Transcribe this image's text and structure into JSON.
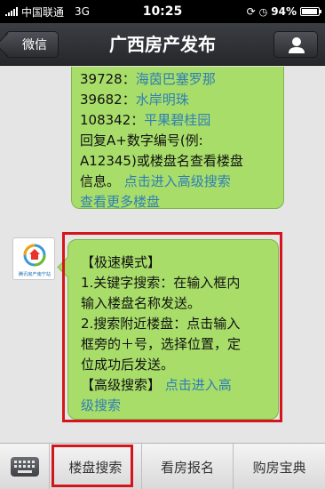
{
  "status_bar": {
    "carrier": "中国联通",
    "network": "3G",
    "time": "10:25",
    "battery": "94%"
  },
  "nav": {
    "back_label": "微信",
    "title": "广西房产发布"
  },
  "messages": [
    {
      "lines": [
        {
          "prefix": "39728：",
          "link": "海茵巴塞罗那"
        },
        {
          "prefix": "39682：",
          "link": "水岸明珠"
        },
        {
          "prefix": "108342：",
          "link": "平果碧桂园"
        },
        {
          "text": "回复A+数字编号(例:"
        },
        {
          "text": "A12345)或楼盘名查看楼盘"
        },
        {
          "prefix": "信息。 ",
          "link": "点击进入高级搜索"
        },
        {
          "link": "查看更多楼盘"
        }
      ]
    },
    {
      "avatar_text": "腾讯房产南宁站",
      "lines": [
        {
          "text": "【极速模式】"
        },
        {
          "text": "1.关键字搜索：在输入框内"
        },
        {
          "text": "输入楼盘名称发送。"
        },
        {
          "text": "2.搜索附近楼盘：点击输入"
        },
        {
          "text": "框旁的＋号，选择位置，定"
        },
        {
          "text": "位成功后发送。"
        },
        {
          "prefix": "【高级搜索】 ",
          "link": "点击进入高"
        },
        {
          "link": "级搜索"
        }
      ]
    }
  ],
  "toolbar": {
    "keyboard_icon": "keyboard-icon",
    "menus": [
      "楼盘搜索",
      "看房报名",
      "购房宝典"
    ]
  },
  "colors": {
    "bubble": "#a8dd6a",
    "link": "#2f7fb4",
    "highlight": "#d4161c"
  }
}
